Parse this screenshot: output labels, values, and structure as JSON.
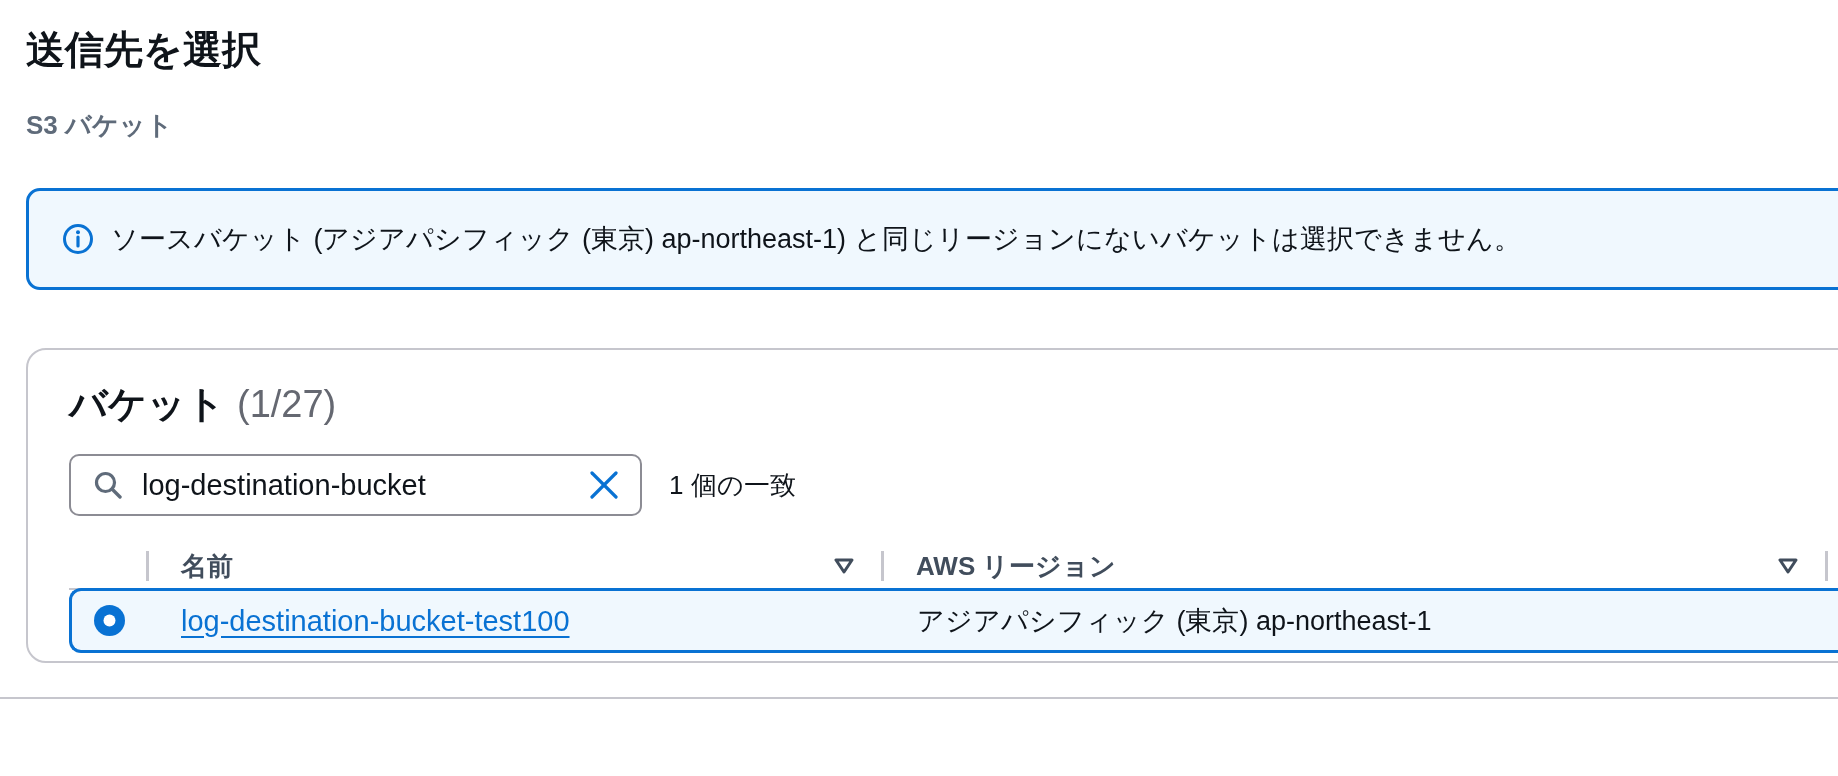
{
  "page": {
    "title": "送信先を選択",
    "subtitle": "S3 バケット"
  },
  "alert": {
    "text": "ソースバケット (アジアパシフィック (東京) ap-northeast-1) と同じリージョンにないバケットは選択できません。"
  },
  "bucket_table": {
    "title": "バケット",
    "count": "(1/27)",
    "search": {
      "value": "log-destination-bucket"
    },
    "match_count": "1 個の一致",
    "columns": [
      {
        "label": "名前"
      },
      {
        "label": "AWS リージョン"
      }
    ],
    "rows": [
      {
        "selected": true,
        "name": "log-destination-bucket-test100",
        "region": "アジアパシフィック (東京) ap-northeast-1"
      }
    ]
  }
}
